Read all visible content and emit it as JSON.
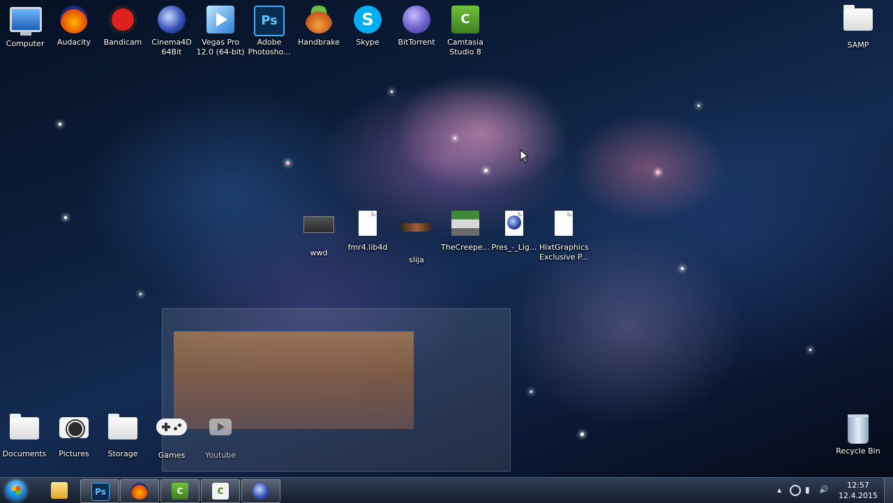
{
  "desktop": {
    "top_icons": [
      {
        "label": "Computer",
        "icon": "computer-icon"
      },
      {
        "label": "Audacity",
        "icon": "audacity-icon"
      },
      {
        "label": "Bandicam",
        "icon": "bandicam-icon"
      },
      {
        "label": "Cinema4D 64Bit",
        "line1": "Cinema4D",
        "line2": "64Bit",
        "icon": "cinema4d-icon"
      },
      {
        "label": "Vegas Pro 12.0 (64-bit)",
        "line1": "Vegas Pro",
        "line2": "12.0 (64-bit)",
        "icon": "vegas-pro-icon"
      },
      {
        "label": "Adobe Photosho...",
        "line1": "Adobe",
        "line2": "Photosho...",
        "icon": "photoshop-icon",
        "glyph": "Ps"
      },
      {
        "label": "Handbrake",
        "icon": "handbrake-icon"
      },
      {
        "label": "Skype",
        "icon": "skype-icon",
        "glyph": "S"
      },
      {
        "label": "BitTorrent",
        "icon": "bittorrent-icon"
      },
      {
        "label": "Camtasia Studio 8",
        "line1": "Camtasia",
        "line2": "Studio 8",
        "icon": "camtasia-icon",
        "glyph": "C"
      },
      {
        "label": "SAMP",
        "icon": "folder-icon"
      }
    ],
    "middle_icons": [
      {
        "label": "wwd",
        "icon": "image-file-icon"
      },
      {
        "label": "fmr4.lib4d",
        "icon": "file-icon"
      },
      {
        "label": "slija",
        "icon": "image-file-icon"
      },
      {
        "label": "TheCreepe...",
        "icon": "image-file-icon"
      },
      {
        "label": "Pres_-_Lig...",
        "icon": "cinema4d-file-icon"
      },
      {
        "label": "HixtGraphics Exclusive P...",
        "line1": "HixtGraphics",
        "line2": "Exclusive P...",
        "icon": "file-icon"
      }
    ],
    "bottom_icons": [
      {
        "label": "Documents",
        "icon": "folder-icon"
      },
      {
        "label": "Pictures",
        "icon": "camera-icon"
      },
      {
        "label": "Storage",
        "icon": "folder-icon"
      },
      {
        "label": "Games",
        "icon": "gamepad-icon"
      },
      {
        "label": "Youtube",
        "icon": "youtube-icon"
      },
      {
        "label": "Recycle Bin",
        "icon": "recycle-bin-icon"
      }
    ]
  },
  "taskbar": {
    "pinned": [
      {
        "name": "explorer",
        "icon": "folder-icon"
      },
      {
        "name": "photoshop",
        "icon": "photoshop-icon",
        "glyph": "Ps"
      },
      {
        "name": "audacity",
        "icon": "audacity-icon"
      },
      {
        "name": "camtasia",
        "icon": "camtasia-icon",
        "glyph": "C"
      },
      {
        "name": "camtasia-recorder",
        "icon": "camtasia-icon",
        "glyph": "C"
      },
      {
        "name": "cinema4d",
        "icon": "cinema4d-icon"
      }
    ],
    "clock": {
      "time": "12:57",
      "date": "12.4.2015"
    },
    "tray_glyphs": {
      "arrow": "▲",
      "network": "▮",
      "volume": "🔊"
    }
  },
  "colors": {
    "bandicam": "#d81b1b",
    "photoshop": "#0a2b4d",
    "skype": "#00aff0",
    "camtasia": "#4f9a2a",
    "bittorrent": "#6c5fc9"
  }
}
